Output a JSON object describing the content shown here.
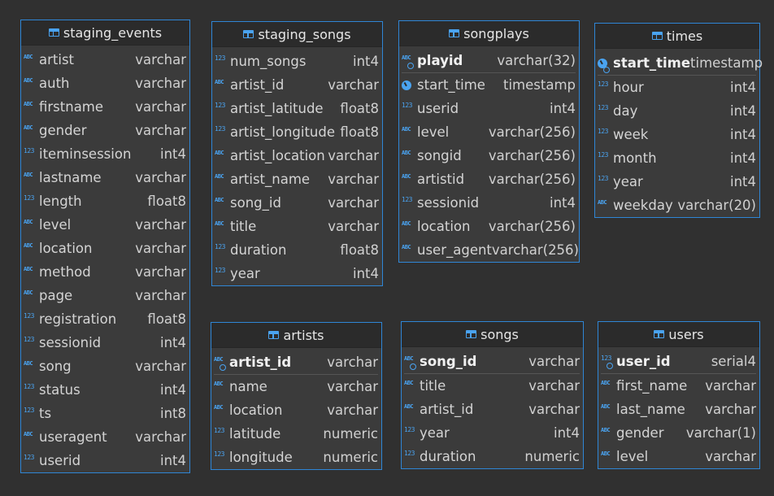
{
  "tables": [
    {
      "name": "staging_events",
      "columns": [
        {
          "icon": "abc",
          "name": "artist",
          "type": "varchar"
        },
        {
          "icon": "abc",
          "name": "auth",
          "type": "varchar"
        },
        {
          "icon": "abc",
          "name": "firstname",
          "type": "varchar"
        },
        {
          "icon": "abc",
          "name": "gender",
          "type": "varchar"
        },
        {
          "icon": "123",
          "name": "iteminsession",
          "type": "int4"
        },
        {
          "icon": "abc",
          "name": "lastname",
          "type": "varchar"
        },
        {
          "icon": "123",
          "name": "length",
          "type": "float8"
        },
        {
          "icon": "abc",
          "name": "level",
          "type": "varchar"
        },
        {
          "icon": "abc",
          "name": "location",
          "type": "varchar"
        },
        {
          "icon": "abc",
          "name": "method",
          "type": "varchar"
        },
        {
          "icon": "abc",
          "name": "page",
          "type": "varchar"
        },
        {
          "icon": "123",
          "name": "registration",
          "type": "float8"
        },
        {
          "icon": "123",
          "name": "sessionid",
          "type": "int4"
        },
        {
          "icon": "abc",
          "name": "song",
          "type": "varchar"
        },
        {
          "icon": "123",
          "name": "status",
          "type": "int4"
        },
        {
          "icon": "123",
          "name": "ts",
          "type": "int8"
        },
        {
          "icon": "abc",
          "name": "useragent",
          "type": "varchar"
        },
        {
          "icon": "123",
          "name": "userid",
          "type": "int4"
        }
      ]
    },
    {
      "name": "staging_songs",
      "columns": [
        {
          "icon": "123",
          "name": "num_songs",
          "type": "int4"
        },
        {
          "icon": "abc",
          "name": "artist_id",
          "type": "varchar"
        },
        {
          "icon": "123",
          "name": "artist_latitude",
          "type": "float8"
        },
        {
          "icon": "123",
          "name": "artist_longitude",
          "type": "float8"
        },
        {
          "icon": "abc",
          "name": "artist_location",
          "type": "varchar"
        },
        {
          "icon": "abc",
          "name": "artist_name",
          "type": "varchar"
        },
        {
          "icon": "abc",
          "name": "song_id",
          "type": "varchar"
        },
        {
          "icon": "abc",
          "name": "title",
          "type": "varchar"
        },
        {
          "icon": "123",
          "name": "duration",
          "type": "float8"
        },
        {
          "icon": "123",
          "name": "year",
          "type": "int4"
        }
      ]
    },
    {
      "name": "songplays",
      "columns": [
        {
          "icon": "abc",
          "name": "playid",
          "type": "varchar(32)",
          "pk": true
        },
        {
          "icon": "clock",
          "name": "start_time",
          "type": "timestamp"
        },
        {
          "icon": "123",
          "name": "userid",
          "type": "int4"
        },
        {
          "icon": "abc",
          "name": "level",
          "type": "varchar(256)"
        },
        {
          "icon": "abc",
          "name": "songid",
          "type": "varchar(256)"
        },
        {
          "icon": "abc",
          "name": "artistid",
          "type": "varchar(256)"
        },
        {
          "icon": "123",
          "name": "sessionid",
          "type": "int4"
        },
        {
          "icon": "abc",
          "name": "location",
          "type": "varchar(256)"
        },
        {
          "icon": "abc",
          "name": "user_agent",
          "type": "varchar(256)"
        }
      ]
    },
    {
      "name": "times",
      "columns": [
        {
          "icon": "clock",
          "name": "start_time",
          "type": "timestamp",
          "pk": true
        },
        {
          "icon": "123",
          "name": "hour",
          "type": "int4"
        },
        {
          "icon": "123",
          "name": "day",
          "type": "int4"
        },
        {
          "icon": "123",
          "name": "week",
          "type": "int4"
        },
        {
          "icon": "123",
          "name": "month",
          "type": "int4"
        },
        {
          "icon": "123",
          "name": "year",
          "type": "int4"
        },
        {
          "icon": "abc",
          "name": "weekday",
          "type": "varchar(20)"
        }
      ]
    },
    {
      "name": "artists",
      "columns": [
        {
          "icon": "abc",
          "name": "artist_id",
          "type": "varchar",
          "pk": true
        },
        {
          "icon": "abc",
          "name": "name",
          "type": "varchar"
        },
        {
          "icon": "abc",
          "name": "location",
          "type": "varchar"
        },
        {
          "icon": "123",
          "name": "latitude",
          "type": "numeric"
        },
        {
          "icon": "123",
          "name": "longitude",
          "type": "numeric"
        }
      ]
    },
    {
      "name": "songs",
      "columns": [
        {
          "icon": "abc",
          "name": "song_id",
          "type": "varchar",
          "pk": true
        },
        {
          "icon": "abc",
          "name": "title",
          "type": "varchar"
        },
        {
          "icon": "abc",
          "name": "artist_id",
          "type": "varchar"
        },
        {
          "icon": "123",
          "name": "year",
          "type": "int4"
        },
        {
          "icon": "123",
          "name": "duration",
          "type": "numeric"
        }
      ]
    },
    {
      "name": "users",
      "columns": [
        {
          "icon": "123",
          "name": "user_id",
          "type": "serial4",
          "pk": true
        },
        {
          "icon": "abc",
          "name": "first_name",
          "type": "varchar"
        },
        {
          "icon": "abc",
          "name": "last_name",
          "type": "varchar"
        },
        {
          "icon": "abc",
          "name": "gender",
          "type": "varchar(1)"
        },
        {
          "icon": "abc",
          "name": "level",
          "type": "varchar"
        }
      ]
    }
  ]
}
